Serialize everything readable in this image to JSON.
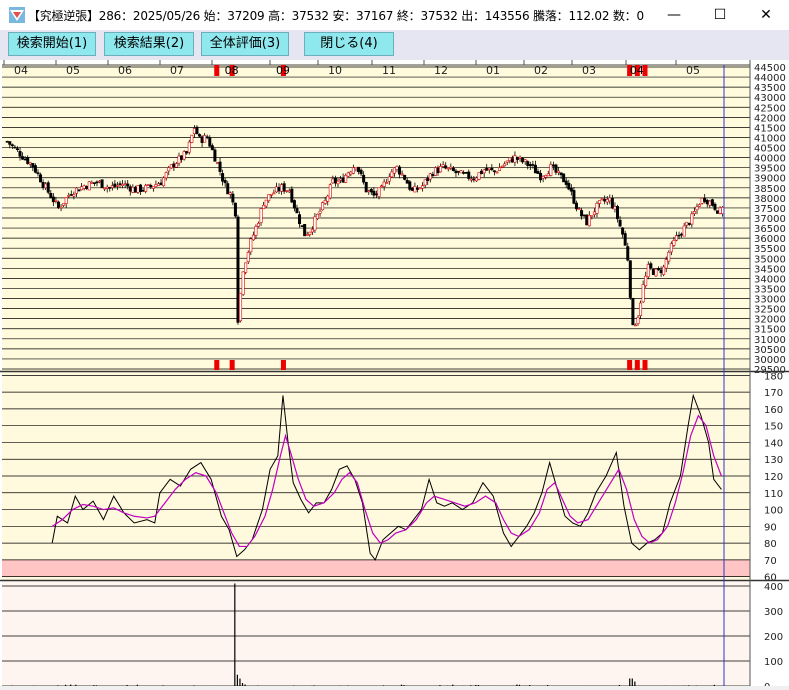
{
  "window": {
    "title": "【究極逆張】286：2025/05/26  始：37209  高：37532  安：37167  終：37532  出：143556  騰落：112.02  数：0",
    "minimize": "—",
    "maximize": "☐",
    "close": "✕"
  },
  "toolbar": {
    "search_start": "検索開始(1)",
    "search_results": "検索結果(2)",
    "overall_eval": "全体評価(3)",
    "close": "閉じる(4)"
  },
  "colors": {
    "price_bg": "#fffbdc",
    "osc_bg": "#fff9de",
    "vol_bg": "#fff5f0",
    "band": "#ffc4c4",
    "up_candle": "#e00000",
    "down_candle": "#000000",
    "signal": "#ee0000",
    "ma_line": "#c000c0",
    "cursor": "#3333cc"
  },
  "chart_data": [
    {
      "type": "candlestick",
      "name": "price",
      "x_ticks": [
        "04",
        "05",
        "06",
        "07",
        "08",
        "09",
        "10",
        "11",
        "12",
        "01",
        "02",
        "03",
        "04",
        "05"
      ],
      "y_ticks": [
        29500,
        30000,
        30500,
        31000,
        31500,
        32000,
        32500,
        33000,
        33500,
        34000,
        34500,
        35000,
        35500,
        36000,
        36500,
        37000,
        37500,
        38000,
        38500,
        39000,
        39500,
        40000,
        40500,
        41000,
        41500,
        42000,
        42500,
        43000,
        43500,
        44000,
        44500
      ],
      "ylim": [
        29400,
        44600
      ],
      "last_bar": {
        "date": "2025/05/26",
        "open": 37209,
        "high": 37532,
        "low": 37167,
        "close": 37532,
        "volume": 143556
      },
      "close_path": [
        [
          0,
          40800
        ],
        [
          5,
          40200
        ],
        [
          10,
          39600
        ],
        [
          15,
          38500
        ],
        [
          20,
          37500
        ],
        [
          25,
          38300
        ],
        [
          30,
          38600
        ],
        [
          35,
          38800
        ],
        [
          40,
          38500
        ],
        [
          45,
          38700
        ],
        [
          50,
          38400
        ],
        [
          55,
          38500
        ],
        [
          60,
          38800
        ],
        [
          65,
          39700
        ],
        [
          70,
          40200
        ],
        [
          73,
          41500
        ],
        [
          75,
          40900
        ],
        [
          78,
          41000
        ],
        [
          82,
          39700
        ],
        [
          85,
          38600
        ],
        [
          87,
          38200
        ],
        [
          89,
          37300
        ],
        [
          90,
          32000
        ],
        [
          92,
          34500
        ],
        [
          95,
          35800
        ],
        [
          98,
          36900
        ],
        [
          100,
          37800
        ],
        [
          103,
          38200
        ],
        [
          107,
          38500
        ],
        [
          110,
          38400
        ],
        [
          113,
          37200
        ],
        [
          116,
          36200
        ],
        [
          118,
          36400
        ],
        [
          121,
          37100
        ],
        [
          124,
          37800
        ],
        [
          127,
          38800
        ],
        [
          130,
          38800
        ],
        [
          133,
          39300
        ],
        [
          136,
          39700
        ],
        [
          140,
          38400
        ],
        [
          143,
          38100
        ],
        [
          146,
          38400
        ],
        [
          149,
          39200
        ],
        [
          152,
          39500
        ],
        [
          155,
          39000
        ],
        [
          158,
          38300
        ],
        [
          162,
          38600
        ],
        [
          166,
          39300
        ],
        [
          170,
          39500
        ],
        [
          174,
          39300
        ],
        [
          178,
          39100
        ],
        [
          182,
          39000
        ],
        [
          186,
          39400
        ],
        [
          190,
          39300
        ],
        [
          194,
          39700
        ],
        [
          198,
          40000
        ],
        [
          201,
          39800
        ],
        [
          204,
          39600
        ],
        [
          208,
          39100
        ],
        [
          212,
          39500
        ],
        [
          216,
          39000
        ],
        [
          218,
          38800
        ],
        [
          220,
          38200
        ],
        [
          223,
          37300
        ],
        [
          226,
          36800
        ],
        [
          229,
          37400
        ],
        [
          232,
          37800
        ],
        [
          235,
          37900
        ],
        [
          237,
          37400
        ],
        [
          240,
          36200
        ],
        [
          242,
          35000
        ],
        [
          244,
          31500
        ],
        [
          246,
          32200
        ],
        [
          248,
          33600
        ],
        [
          250,
          34500
        ],
        [
          253,
          34300
        ],
        [
          256,
          34500
        ],
        [
          258,
          35300
        ],
        [
          261,
          36000
        ],
        [
          264,
          36500
        ],
        [
          267,
          37000
        ],
        [
          270,
          37800
        ],
        [
          272,
          38000
        ],
        [
          275,
          37700
        ],
        [
          278,
          37300
        ],
        [
          280,
          37532
        ]
      ],
      "signals": [
        82,
        88,
        108,
        243,
        246,
        249
      ],
      "signal_labels": [
        "08",
        "09",
        "04"
      ]
    },
    {
      "type": "line",
      "name": "騰落",
      "y_ticks": [
        60,
        70,
        80,
        90,
        100,
        110,
        120,
        130,
        140,
        150,
        160,
        170,
        180
      ],
      "ylim": [
        58,
        182
      ],
      "shaded_band": [
        60,
        70
      ],
      "series_raw": [
        [
          18,
          80
        ],
        [
          20,
          96
        ],
        [
          24,
          92
        ],
        [
          27,
          108
        ],
        [
          30,
          100
        ],
        [
          34,
          105
        ],
        [
          38,
          94
        ],
        [
          42,
          108
        ],
        [
          46,
          98
        ],
        [
          50,
          92
        ],
        [
          55,
          94
        ],
        [
          58,
          92
        ],
        [
          60,
          110
        ],
        [
          64,
          118
        ],
        [
          68,
          114
        ],
        [
          72,
          124
        ],
        [
          76,
          128
        ],
        [
          80,
          118
        ],
        [
          84,
          96
        ],
        [
          87,
          88
        ],
        [
          90,
          72
        ],
        [
          93,
          76
        ],
        [
          96,
          82
        ],
        [
          100,
          100
        ],
        [
          103,
          124
        ],
        [
          106,
          132
        ],
        [
          108,
          168
        ],
        [
          110,
          140
        ],
        [
          112,
          116
        ],
        [
          115,
          106
        ],
        [
          118,
          98
        ],
        [
          121,
          104
        ],
        [
          124,
          104
        ],
        [
          127,
          112
        ],
        [
          130,
          124
        ],
        [
          133,
          126
        ],
        [
          136,
          118
        ],
        [
          139,
          104
        ],
        [
          142,
          74
        ],
        [
          144,
          70
        ],
        [
          147,
          82
        ],
        [
          150,
          86
        ],
        [
          153,
          90
        ],
        [
          156,
          88
        ],
        [
          159,
          94
        ],
        [
          162,
          100
        ],
        [
          165,
          118
        ],
        [
          168,
          104
        ],
        [
          171,
          102
        ],
        [
          174,
          104
        ],
        [
          178,
          100
        ],
        [
          182,
          104
        ],
        [
          186,
          116
        ],
        [
          190,
          108
        ],
        [
          194,
          86
        ],
        [
          197,
          78
        ],
        [
          200,
          84
        ],
        [
          203,
          90
        ],
        [
          206,
          98
        ],
        [
          209,
          110
        ],
        [
          212,
          128
        ],
        [
          215,
          112
        ],
        [
          218,
          96
        ],
        [
          221,
          92
        ],
        [
          224,
          90
        ],
        [
          227,
          98
        ],
        [
          230,
          110
        ],
        [
          234,
          120
        ],
        [
          238,
          134
        ],
        [
          241,
          102
        ],
        [
          244,
          80
        ],
        [
          247,
          76
        ],
        [
          250,
          80
        ],
        [
          253,
          82
        ],
        [
          256,
          86
        ],
        [
          259,
          104
        ],
        [
          263,
          120
        ],
        [
          266,
          150
        ],
        [
          268,
          168
        ],
        [
          271,
          156
        ],
        [
          274,
          140
        ],
        [
          276,
          118
        ],
        [
          279,
          112
        ]
      ],
      "series_ma": [
        [
          18,
          90
        ],
        [
          22,
          94
        ],
        [
          26,
          100
        ],
        [
          30,
          103
        ],
        [
          34,
          102
        ],
        [
          38,
          100
        ],
        [
          42,
          101
        ],
        [
          46,
          98
        ],
        [
          50,
          96
        ],
        [
          55,
          95
        ],
        [
          58,
          96
        ],
        [
          62,
          104
        ],
        [
          66,
          112
        ],
        [
          70,
          118
        ],
        [
          74,
          122
        ],
        [
          78,
          120
        ],
        [
          82,
          110
        ],
        [
          85,
          98
        ],
        [
          88,
          86
        ],
        [
          91,
          78
        ],
        [
          94,
          78
        ],
        [
          97,
          84
        ],
        [
          101,
          96
        ],
        [
          104,
          112
        ],
        [
          107,
          132
        ],
        [
          109,
          144
        ],
        [
          111,
          134
        ],
        [
          114,
          118
        ],
        [
          117,
          106
        ],
        [
          120,
          102
        ],
        [
          124,
          104
        ],
        [
          128,
          110
        ],
        [
          131,
          118
        ],
        [
          134,
          122
        ],
        [
          137,
          116
        ],
        [
          140,
          100
        ],
        [
          143,
          86
        ],
        [
          146,
          80
        ],
        [
          149,
          82
        ],
        [
          152,
          86
        ],
        [
          156,
          88
        ],
        [
          160,
          94
        ],
        [
          164,
          104
        ],
        [
          167,
          108
        ],
        [
          171,
          106
        ],
        [
          175,
          104
        ],
        [
          179,
          102
        ],
        [
          183,
          104
        ],
        [
          187,
          108
        ],
        [
          191,
          104
        ],
        [
          194,
          94
        ],
        [
          197,
          86
        ],
        [
          200,
          84
        ],
        [
          204,
          88
        ],
        [
          208,
          98
        ],
        [
          211,
          112
        ],
        [
          214,
          116
        ],
        [
          217,
          106
        ],
        [
          220,
          96
        ],
        [
          223,
          92
        ],
        [
          227,
          94
        ],
        [
          231,
          104
        ],
        [
          235,
          114
        ],
        [
          239,
          124
        ],
        [
          242,
          112
        ],
        [
          245,
          94
        ],
        [
          248,
          84
        ],
        [
          251,
          80
        ],
        [
          254,
          82
        ],
        [
          258,
          90
        ],
        [
          261,
          104
        ],
        [
          264,
          122
        ],
        [
          267,
          144
        ],
        [
          270,
          156
        ],
        [
          273,
          150
        ],
        [
          276,
          132
        ],
        [
          279,
          120
        ]
      ]
    },
    {
      "type": "bar",
      "name": "出来高",
      "y_ticks": [
        0,
        100,
        200,
        300,
        400
      ],
      "ylim": [
        0,
        420
      ]
    }
  ]
}
